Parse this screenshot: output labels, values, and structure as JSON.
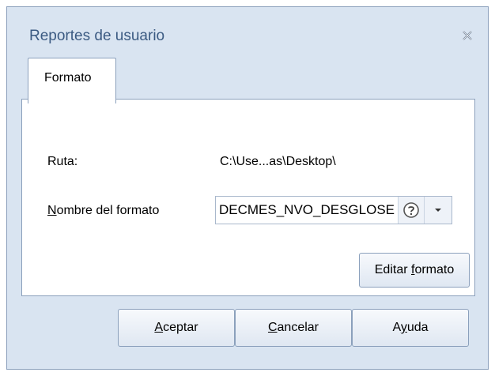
{
  "window": {
    "title": "Reportes de usuario"
  },
  "tabs": [
    {
      "label": "Formato",
      "selected": true
    }
  ],
  "form": {
    "ruta_label": "Ruta:",
    "ruta_value": "C:\\Use...as\\Desktop\\",
    "nombre_label_mnemonic": "N",
    "nombre_label_rest": "ombre del formato",
    "nombre_value": "DECMES_NVO_DESGLOSE",
    "editar_label_prefix": "Editar ",
    "editar_label_mnemonic": "f",
    "editar_label_suffix": "ormato"
  },
  "footer": {
    "aceptar_mnemonic": "A",
    "aceptar_rest": "ceptar",
    "cancelar_mnemonic": "C",
    "cancelar_rest": "ancelar",
    "ayuda_prefix": "A",
    "ayuda_mnemonic": "y",
    "ayuda_suffix": "uda"
  },
  "colors": {
    "frame": "#d9e4f1",
    "border": "#8ba0bc",
    "title_text": "#3b5a82"
  }
}
